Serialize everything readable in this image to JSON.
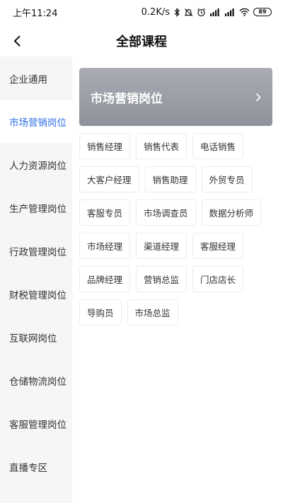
{
  "status_bar": {
    "time": "上午11:24",
    "speed": "0.2K/s",
    "battery": "89"
  },
  "header": {
    "title": "全部课程"
  },
  "sidebar": {
    "items": [
      {
        "label": "企业通用",
        "active": false
      },
      {
        "label": "市场营销岗位",
        "active": true
      },
      {
        "label": "人力资源岗位",
        "active": false
      },
      {
        "label": "生产管理岗位",
        "active": false
      },
      {
        "label": "行政管理岗位",
        "active": false
      },
      {
        "label": "财税管理岗位",
        "active": false
      },
      {
        "label": "互联网岗位",
        "active": false
      },
      {
        "label": "仓储物流岗位",
        "active": false
      },
      {
        "label": "客服管理岗位",
        "active": false
      },
      {
        "label": "直播专区",
        "active": false
      }
    ]
  },
  "banner": {
    "title": "市场营销岗位"
  },
  "tags": [
    [
      "销售经理",
      "销售代表",
      "电话销售"
    ],
    [
      "大客户经理",
      "销售助理",
      "外贸专员"
    ],
    [
      "客服专员",
      "市场调查员",
      "数据分析师"
    ],
    [
      "市场经理",
      "渠道经理",
      "客服经理"
    ],
    [
      "品牌经理",
      "营销总监",
      "门店店长"
    ],
    [
      "导购员",
      "市场总监"
    ]
  ],
  "colors": {
    "accent": "#2f6fe8",
    "sidebar_bg": "#f5f6f8",
    "banner_bg": "#9a9da4"
  }
}
